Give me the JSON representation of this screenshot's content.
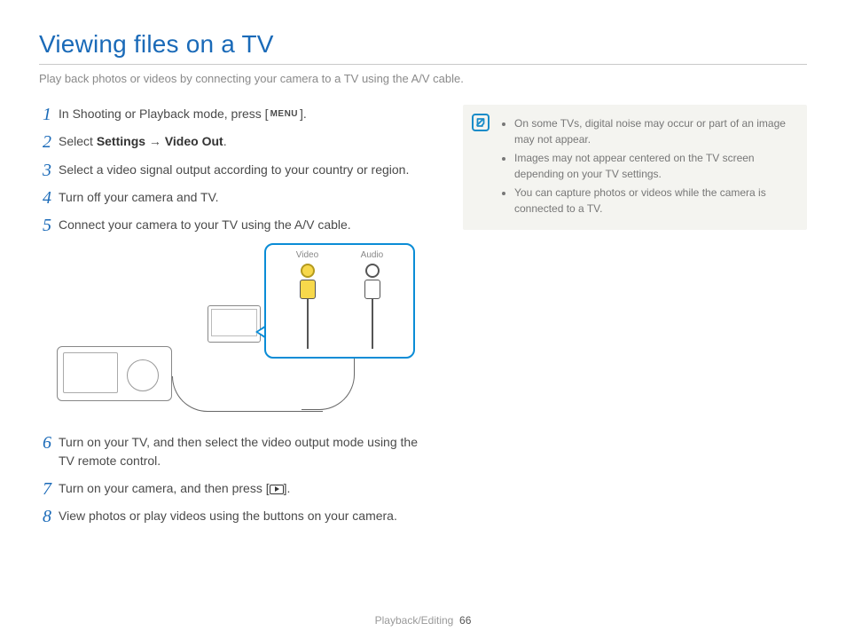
{
  "title": "Viewing files on a TV",
  "subtitle": "Play back photos or videos by connecting your camera to a TV using the A/V cable.",
  "steps": {
    "s1_pre": "In Shooting or Playback mode, press [",
    "s1_btn": "MENU",
    "s1_post": "].",
    "s2_pre": "Select ",
    "s2_bold1": "Settings",
    "s2_arrow": " → ",
    "s2_bold2": "Video Out",
    "s2_post": ".",
    "s3": "Select a video signal output according to your country or region.",
    "s4": "Turn off your camera and TV.",
    "s5": "Connect your camera to your TV using the A/V cable.",
    "s6": "Turn on your TV, and then select the video output mode using the TV remote control.",
    "s7_pre": "Turn on your camera, and then press [",
    "s7_post": "].",
    "s8": "View photos or play videos using the buttons on your camera."
  },
  "diagram": {
    "video_label": "Video",
    "audio_label": "Audio"
  },
  "notes": {
    "n1": "On some TVs, digital noise may occur or part of an image may not appear.",
    "n2": "Images may not appear centered on the TV screen depending on your TV settings.",
    "n3": "You can capture photos or videos while the camera is connected to a TV."
  },
  "footer": {
    "section": "Playback/Editing",
    "page": "66"
  }
}
